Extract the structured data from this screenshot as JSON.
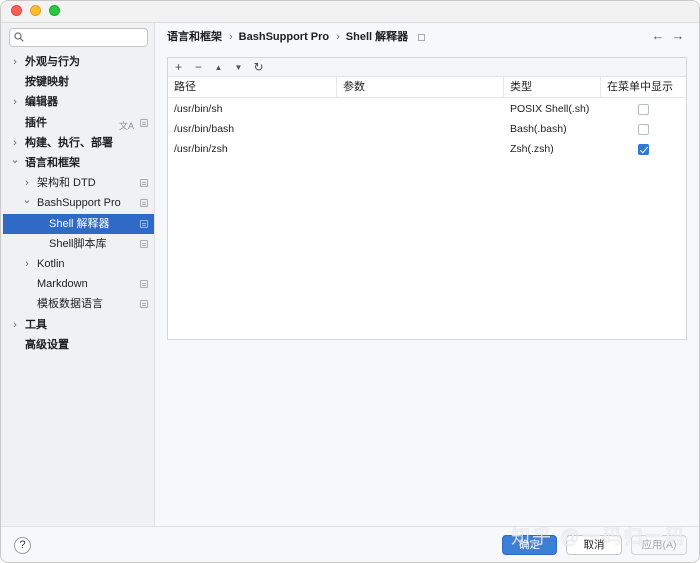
{
  "sidebar": {
    "search": {
      "placeholder": "",
      "value": ""
    },
    "items": [
      {
        "label": "外观与行为",
        "expandable": true,
        "expanded": false,
        "bold": true
      },
      {
        "label": "按键映射",
        "expandable": false,
        "bold": true
      },
      {
        "label": "编辑器",
        "expandable": true,
        "expanded": false,
        "bold": true
      },
      {
        "label": "插件",
        "expandable": false,
        "bold": true,
        "icons": [
          "translate-icon",
          "settings-badge-icon"
        ]
      },
      {
        "label": "构建、执行、部署",
        "expandable": true,
        "expanded": false,
        "bold": true
      },
      {
        "label": "语言和框架",
        "expandable": true,
        "expanded": true,
        "bold": true
      },
      {
        "label": "架构和 DTD",
        "expandable": true,
        "expanded": false,
        "bold": false,
        "badge": true
      },
      {
        "label": "BashSupport Pro",
        "expandable": true,
        "expanded": true,
        "bold": false,
        "badge": true
      },
      {
        "label": "Shell 解释器",
        "expandable": false,
        "bold": false,
        "selected": true,
        "badge": true
      },
      {
        "label": "Shell脚本库",
        "expandable": false,
        "bold": false,
        "badge": true
      },
      {
        "label": "Kotlin",
        "expandable": true,
        "expanded": false,
        "bold": false
      },
      {
        "label": "Markdown",
        "expandable": false,
        "bold": false,
        "badge": true
      },
      {
        "label": "模板数据语言",
        "expandable": false,
        "bold": false,
        "badge": true
      },
      {
        "label": "工具",
        "expandable": true,
        "expanded": false,
        "bold": true
      },
      {
        "label": "高级设置",
        "expandable": false,
        "bold": true
      }
    ]
  },
  "breadcrumb": [
    "语言和框架",
    "BashSupport Pro",
    "Shell 解释器"
  ],
  "toolbar": {
    "icons": [
      "add-icon",
      "remove-icon",
      "move-up-icon",
      "move-down-icon",
      "refresh-icon"
    ],
    "glyphs": [
      "+",
      "−",
      "▲",
      "▼",
      "↻"
    ]
  },
  "table": {
    "columns": [
      "路径",
      "参数",
      "类型",
      "在菜单中显示"
    ],
    "rows": [
      {
        "path": "/usr/bin/sh",
        "args": "",
        "type": "POSIX Shell(.sh)",
        "show_in_menu": false
      },
      {
        "path": "/usr/bin/bash",
        "args": "",
        "type": "Bash(.bash)",
        "show_in_menu": false
      },
      {
        "path": "/usr/bin/zsh",
        "args": "",
        "type": "Zsh(.zsh)",
        "show_in_menu": true
      }
    ]
  },
  "footer": {
    "help": "?",
    "ok": "确定",
    "cancel": "取消",
    "apply": "应用(A)"
  },
  "watermark": "知乎 @一码归一码",
  "colors": {
    "accent": "#2f6ac6",
    "primary_button": "#3b7fd6",
    "checkbox_checked": "#2f78d4"
  }
}
